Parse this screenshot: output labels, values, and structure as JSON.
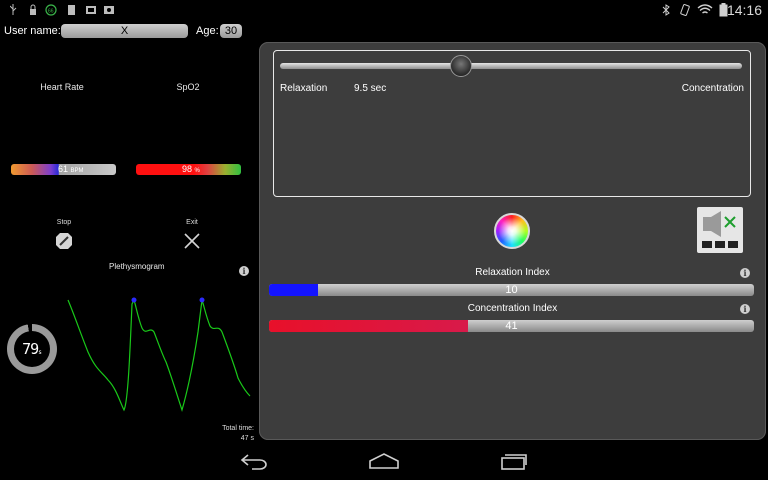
{
  "status_bar": {
    "time": "14:16",
    "left_icons": [
      "usb-icon",
      "lock-icon",
      "sync-icon",
      "sd-card-icon",
      "photo-icon",
      "screenshot-icon"
    ],
    "right_icons": [
      "bluetooth-icon",
      "rotate-icon",
      "wifi-icon",
      "battery-icon"
    ]
  },
  "header": {
    "user_label": "User name:",
    "user_value": "X",
    "age_label": "Age:",
    "age_value": "30"
  },
  "metrics": {
    "heart_rate_label": "Heart Rate",
    "heart_rate_value": "61",
    "heart_rate_unit": "BPM",
    "spo2_label": "SpO2",
    "spo2_value": "98",
    "spo2_unit": "%"
  },
  "controls": {
    "stop_label": "Stop",
    "exit_label": "Exit"
  },
  "plethysmogram": {
    "title": "Plethysmogram",
    "trace_color": "#19c819",
    "peak_color": "#2a2aff"
  },
  "timer": {
    "value": "79",
    "unit": "s"
  },
  "total_time": {
    "label": "Total time:",
    "value": "47 s"
  },
  "session_slider": {
    "left_label": "Relaxation",
    "value_text": "9.5 sec",
    "right_label": "Concentration",
    "position": 0.39
  },
  "relaxation_index": {
    "title": "Relaxation Index",
    "value": "10",
    "fraction": 0.1,
    "color": "#1414ff"
  },
  "concentration_index": {
    "title": "Concentration Index",
    "value": "41",
    "fraction": 0.41,
    "color": "#e8102a"
  },
  "colors": {
    "panel": "#3d3d3d",
    "background": "#000000"
  }
}
